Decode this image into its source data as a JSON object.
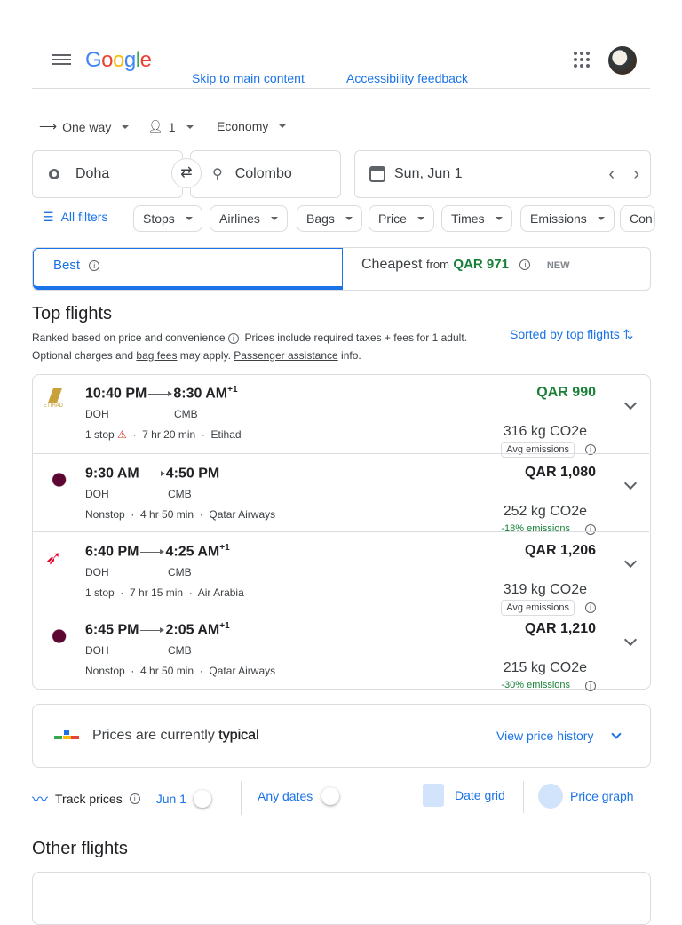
{
  "header": {
    "logo": "Google",
    "skip": "Skip to main content",
    "feedback": "Accessibility feedback"
  },
  "trip": {
    "type": "One way",
    "passengers": "1",
    "cabin": "Economy"
  },
  "search": {
    "origin": "Doha",
    "destination": "Colombo",
    "date": "Sun, Jun 1"
  },
  "filters": {
    "all": "All filters",
    "chips": [
      "Stops",
      "Airlines",
      "Bags",
      "Price",
      "Times",
      "Emissions",
      "Con"
    ]
  },
  "tabs": {
    "best": "Best",
    "cheapest": "Cheapest",
    "from": "from",
    "cheapest_price": "QAR 971",
    "new": "NEW"
  },
  "top": {
    "title": "Top flights",
    "desc1": "Ranked based on price and convenience",
    "desc1b": "Prices include required taxes + fees for 1 adult.",
    "desc2a": "Optional charges and ",
    "bag_fees": "bag fees",
    "desc2b": " may apply. ",
    "passenger": "Passenger assistance",
    "desc2c": " info.",
    "sorted": "Sorted by top flights"
  },
  "flights": [
    {
      "dep": "10:40 PM",
      "arr": "8:30 AM",
      "plus": "+1",
      "from": "DOH",
      "to": "CMB",
      "stops": "1 stop",
      "duration": "7 hr 20 min",
      "airline": "Etihad",
      "price": "QAR 990",
      "co2": "316 kg CO2e",
      "emissions": "Avg emissions"
    },
    {
      "dep": "9:30 AM",
      "arr": "4:50 PM",
      "plus": "",
      "from": "DOH",
      "to": "CMB",
      "stops": "Nonstop",
      "duration": "4 hr 50 min",
      "airline": "Qatar Airways",
      "price": "QAR 1,080",
      "co2": "252 kg CO2e",
      "emissions": "-18% emissions"
    },
    {
      "dep": "6:40 PM",
      "arr": "4:25 AM",
      "plus": "+1",
      "from": "DOH",
      "to": "CMB",
      "stops": "1 stop",
      "duration": "7 hr 15 min",
      "airline": "Air Arabia",
      "price": "QAR 1,206",
      "co2": "319 kg CO2e",
      "emissions": "Avg emissions"
    },
    {
      "dep": "6:45 PM",
      "arr": "2:05 AM",
      "plus": "+1",
      "from": "DOH",
      "to": "CMB",
      "stops": "Nonstop",
      "duration": "4 hr 50 min",
      "airline": "Qatar Airways",
      "price": "QAR 1,210",
      "co2": "215 kg CO2e",
      "emissions": "-30% emissions"
    }
  ],
  "insight": {
    "text": "Prices are currently ",
    "level": "typical",
    "link": "View price history"
  },
  "track": {
    "label": "Track prices",
    "date": "Jun 1",
    "any": "Any dates",
    "grid": "Date grid",
    "graph": "Price graph"
  },
  "other": {
    "title": "Other flights"
  },
  "colors": {
    "accent": "#1a73e8",
    "green": "#188038"
  }
}
